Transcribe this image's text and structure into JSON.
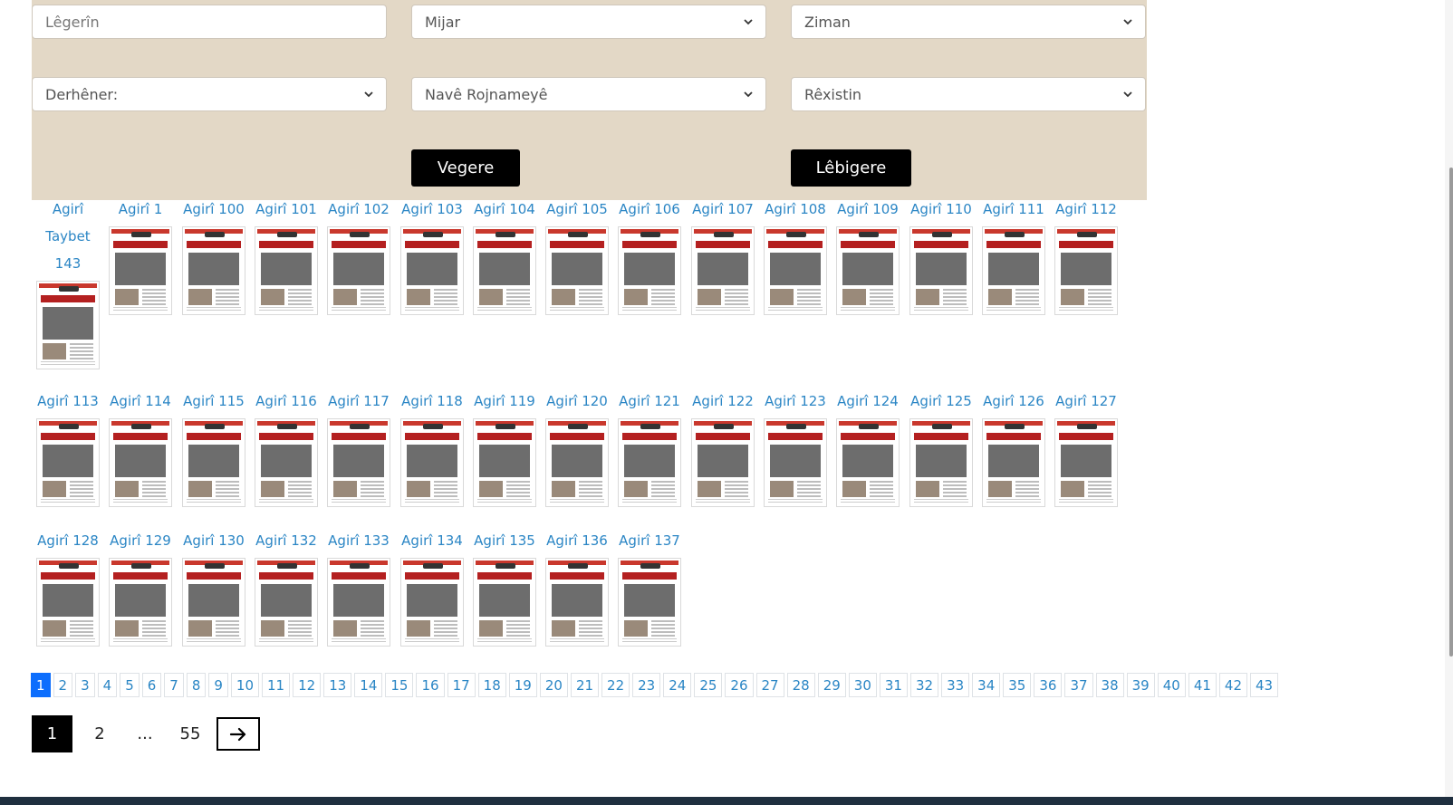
{
  "filters": {
    "search": {
      "placeholder": "Lêgerîn"
    },
    "date": {
      "value": "Mijar"
    },
    "language": {
      "value": "Ziman"
    },
    "publisher": {
      "value": "Derhêner:"
    },
    "newspaper": {
      "value": "Navê Rojnameyê"
    },
    "organization": {
      "value": "Rêxistin"
    },
    "search_button": "Vegere",
    "reset_button": "Lêbigere"
  },
  "issues": [
    "Agirî Taybet 143",
    "Agirî 1",
    "Agirî 100",
    "Agirî 101",
    "Agirî 102",
    "Agirî 103",
    "Agirî 104",
    "Agirî 105",
    "Agirî 106",
    "Agirî 107",
    "Agirî 108",
    "Agirî 109",
    "Agirî 110",
    "Agirî 111",
    "Agirî 112",
    "Agirî 113",
    "Agirî 114",
    "Agirî 115",
    "Agirî 116",
    "Agirî 117",
    "Agirî 118",
    "Agirî 119",
    "Agirî 120",
    "Agirî 121",
    "Agirî 122",
    "Agirî 123",
    "Agirî 124",
    "Agirî 125",
    "Agirî 126",
    "Agirî 127",
    "Agirî 128",
    "Agirî 129",
    "Agirî 130",
    "Agirî 132",
    "Agirî 133",
    "Agirî 134",
    "Agirî 135",
    "Agirî 136",
    "Agirî 137"
  ],
  "page_numbers": [
    "1",
    "2",
    "3",
    "4",
    "5",
    "6",
    "7",
    "8",
    "9",
    "10",
    "11",
    "12",
    "13",
    "14",
    "15",
    "16",
    "17",
    "18",
    "19",
    "20",
    "21",
    "22",
    "23",
    "24",
    "25",
    "26",
    "27",
    "28",
    "29",
    "30",
    "31",
    "32",
    "33",
    "34",
    "35",
    "36",
    "37",
    "38",
    "39",
    "40",
    "41",
    "42",
    "43"
  ],
  "pager": {
    "current": "1",
    "next_page": "2",
    "ellipsis": "...",
    "last": "55"
  },
  "icons": {
    "next": "arrow-right-icon",
    "dropdown": "chevron-down-icon"
  },
  "colors": {
    "panel": "#e3d8c6",
    "link": "#2b86c5",
    "active_page": "#0d6efd",
    "button": "#000000"
  }
}
